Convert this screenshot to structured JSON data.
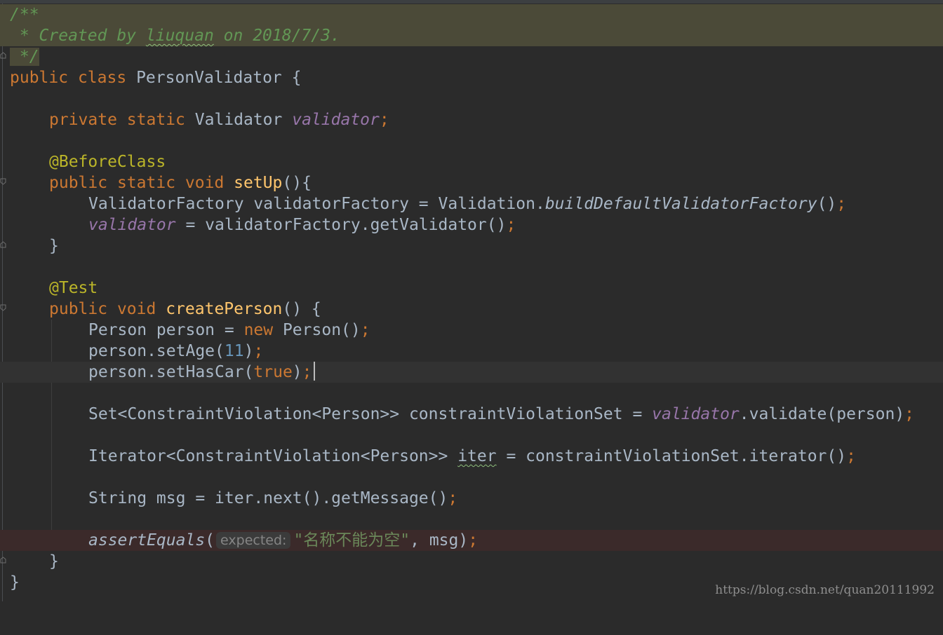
{
  "editor": {
    "doc_open": "/**",
    "doc_line_prefix": " * Created by ",
    "doc_author": "liuquan",
    "doc_line_suffix": " on 2018/7/3.",
    "doc_close": " */",
    "kw_public": "public",
    "kw_class": "class",
    "class_name": "PersonValidator",
    "brace_open": " {",
    "kw_private": "private",
    "kw_static": "static",
    "type_validator": "Validator",
    "field_validator": "validator",
    "semicolon": ";",
    "anno_before_class": "@BeforeClass",
    "kw_void": "void",
    "method_setup": "setUp",
    "setup_params": "(){",
    "factory_decl": "ValidatorFactory validatorFactory = Validation.",
    "factory_method": "buildDefaultValidatorFactory",
    "empty_call": "()",
    "assign_rhs": " = validatorFactory.getValidator()",
    "brace_close": "}",
    "anno_test": "@Test",
    "method_create": "createPerson",
    "create_params": "() {",
    "person_decl": "Person person = ",
    "kw_new": "new",
    "person_ctor": " Person()",
    "set_age": "person.setAge(",
    "age_value": "11",
    "close_paren": ")",
    "set_has_car": "person.setHasCar(",
    "kw_true": "true",
    "set_type": "Set<ConstraintViolation<Person>> constraintViolationSet = ",
    "validate_call": ".validate(person)",
    "iter_type": "Iterator<ConstraintViolation<Person>> ",
    "iter_var": "iter",
    "iter_rhs": " = constraintViolationSet.iterator()",
    "msg_decl": "String msg = iter.next().getMessage()",
    "assert_method": "assertEquals",
    "open_paren": "(",
    "param_hint": "expected:",
    "assert_string": "\"名称不能为空\"",
    "assert_rest": ", msg)"
  },
  "watermark": "https://blog.csdn.net/quan20111992"
}
